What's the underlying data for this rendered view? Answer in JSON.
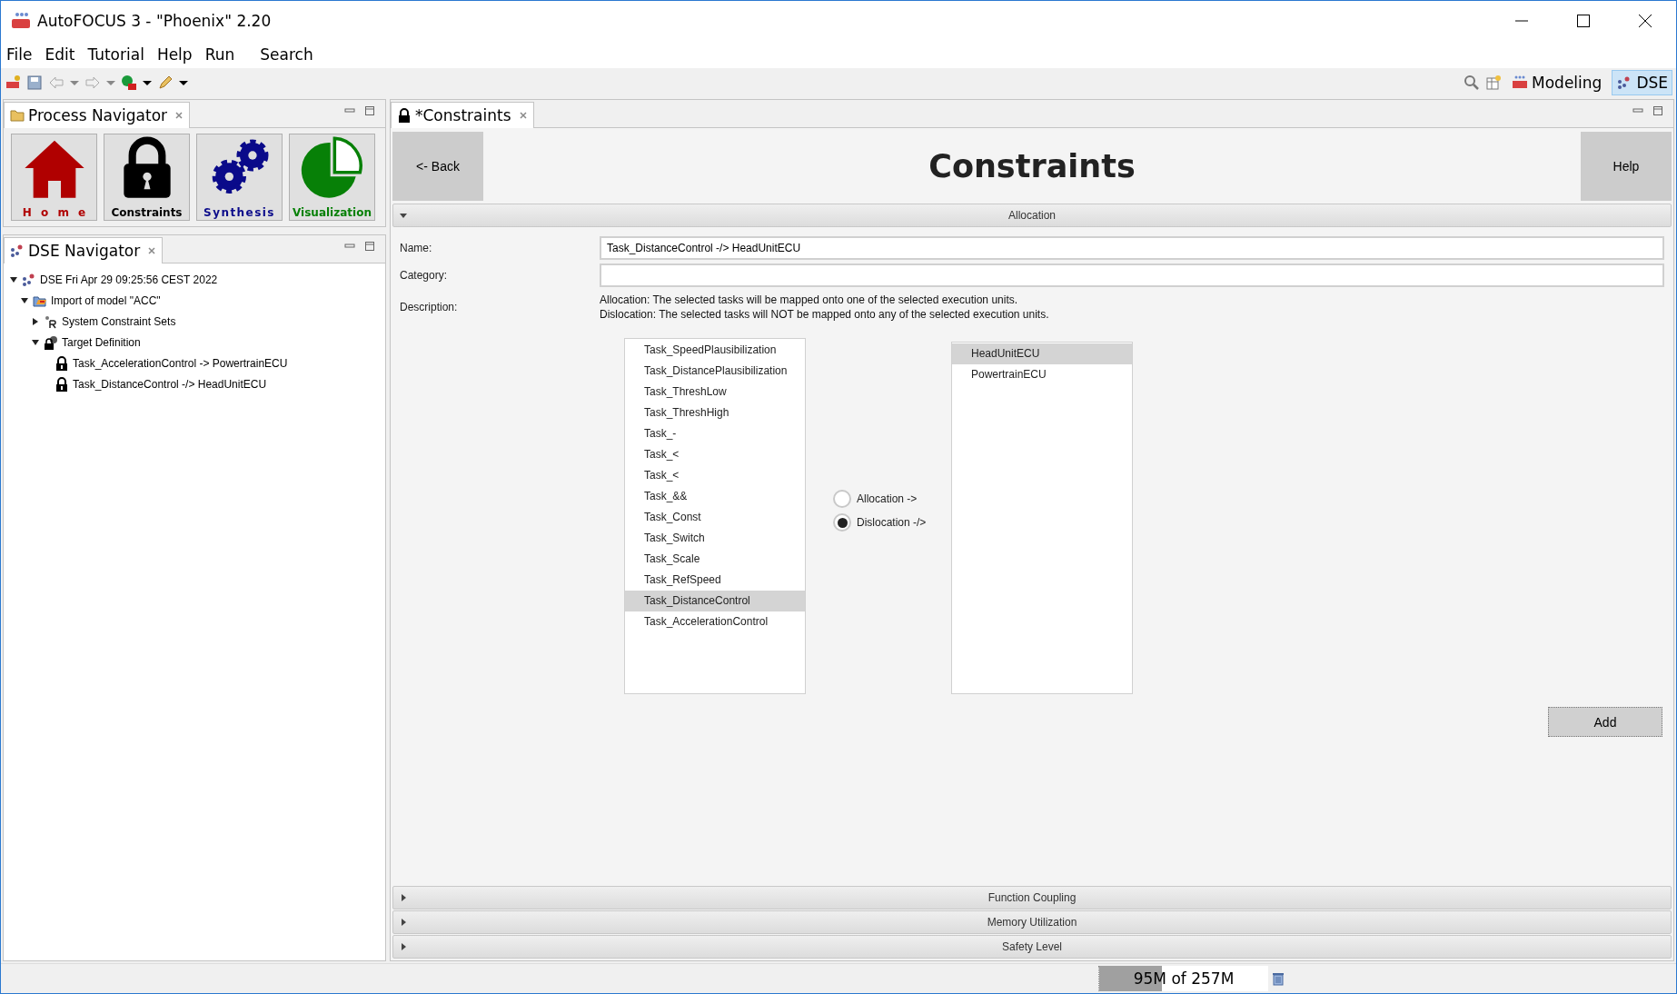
{
  "window": {
    "title": "AutoFOCUS 3 - \"Phoenix\" 2.20"
  },
  "menu": [
    "File",
    "Edit",
    "Tutorial",
    "Help",
    "Run",
    "Search"
  ],
  "perspectives": [
    {
      "label": "Modeling",
      "selected": false,
      "kind": "af3"
    },
    {
      "label": "DSE",
      "selected": true,
      "kind": "dse"
    }
  ],
  "process_navigator": {
    "title": "Process Navigator",
    "items": [
      {
        "label": "Home",
        "kind": "home",
        "color": "#b00000"
      },
      {
        "label": "Constraints",
        "kind": "lock",
        "color": "#000000"
      },
      {
        "label": "Synthesis",
        "kind": "gears",
        "color": "#0a0a8a"
      },
      {
        "label": "Visualization",
        "kind": "pie",
        "color": "#078007"
      }
    ]
  },
  "dse_navigator": {
    "title": "DSE Navigator",
    "tree": [
      {
        "label": "DSE Fri Apr 29 09:25:56 CEST 2022",
        "kind": "dse",
        "expanded": true,
        "children": [
          {
            "label": "Import of model \"ACC\"",
            "kind": "folder",
            "expanded": true,
            "children": [
              {
                "label": "System Constraint Sets",
                "kind": "constraints",
                "expanded": false
              },
              {
                "label": "Target Definition",
                "kind": "target",
                "expanded": true,
                "children": [
                  {
                    "label": "Task_AccelerationControl -> PowertrainECU",
                    "kind": "lock"
                  },
                  {
                    "label": "Task_DistanceControl -/> HeadUnitECU",
                    "kind": "lock"
                  }
                ]
              }
            ]
          }
        ]
      }
    ]
  },
  "editor": {
    "tab_title": "*Constraints",
    "back_button": "<- Back",
    "title": "Constraints",
    "help_button": "Help",
    "sections": [
      {
        "title": "Allocation",
        "expanded": true
      },
      {
        "title": "Function Coupling",
        "expanded": false
      },
      {
        "title": "Memory Utilization",
        "expanded": false
      },
      {
        "title": "Safety Level",
        "expanded": false
      }
    ],
    "form": {
      "name_label": "Name:",
      "name_value": "Task_DistanceControl -/> HeadUnitECU",
      "category_label": "Category:",
      "description_label": "Description:",
      "description_lines": [
        "Allocation: The selected tasks will be mapped onto one of the selected execution units.",
        "Dislocation: The selected tasks will NOT be mapped onto any of the selected execution units."
      ]
    },
    "tasks": [
      {
        "label": "Task_SpeedPlausibilization",
        "selected": false
      },
      {
        "label": "Task_DistancePlausibilization",
        "selected": false
      },
      {
        "label": "Task_ThreshLow",
        "selected": false
      },
      {
        "label": "Task_ThreshHigh",
        "selected": false
      },
      {
        "label": "Task_-",
        "selected": false
      },
      {
        "label": "Task_<",
        "selected": false
      },
      {
        "label": "Task_<",
        "selected": false
      },
      {
        "label": "Task_&&",
        "selected": false
      },
      {
        "label": "Task_Const",
        "selected": false
      },
      {
        "label": "Task_Switch",
        "selected": false
      },
      {
        "label": "Task_Scale",
        "selected": false
      },
      {
        "label": "Task_RefSpeed",
        "selected": false
      },
      {
        "label": "Task_DistanceControl",
        "selected": true
      },
      {
        "label": "Task_AccelerationControl",
        "selected": false
      }
    ],
    "modes": [
      {
        "label": "Allocation ->",
        "selected": false
      },
      {
        "label": "Dislocation -/>",
        "selected": true
      }
    ],
    "units": [
      {
        "label": "HeadUnitECU",
        "selected": true
      },
      {
        "label": "PowertrainECU",
        "selected": false
      }
    ],
    "add_button": "Add"
  },
  "status_bar": {
    "memory": "95M of 257M",
    "level": 0.37
  }
}
